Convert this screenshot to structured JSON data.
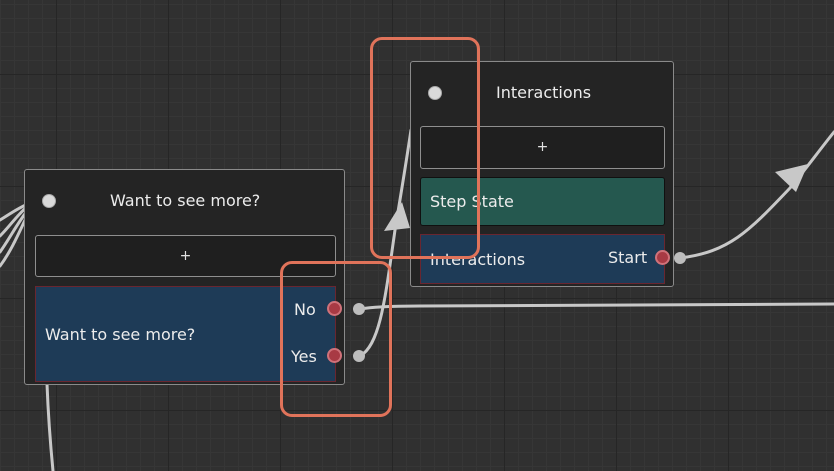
{
  "nodes": {
    "choice_node": {
      "title": "Want to see more?",
      "add_label": "+",
      "prompt_text": "Want to see more?",
      "options": [
        "No",
        "Yes"
      ]
    },
    "interactions_node": {
      "title": "Interactions",
      "add_label": "+",
      "state_label": "Step State",
      "block_label": "Interactions",
      "port_label": "Start"
    }
  },
  "colors": {
    "canvas_background": "#303030",
    "node_background": "#242424",
    "choice_block": "#1e3b57",
    "state_block": "#25584f",
    "output_port": "#a83a44",
    "connection": "#c8c8c8",
    "highlight": "#e0735a"
  }
}
